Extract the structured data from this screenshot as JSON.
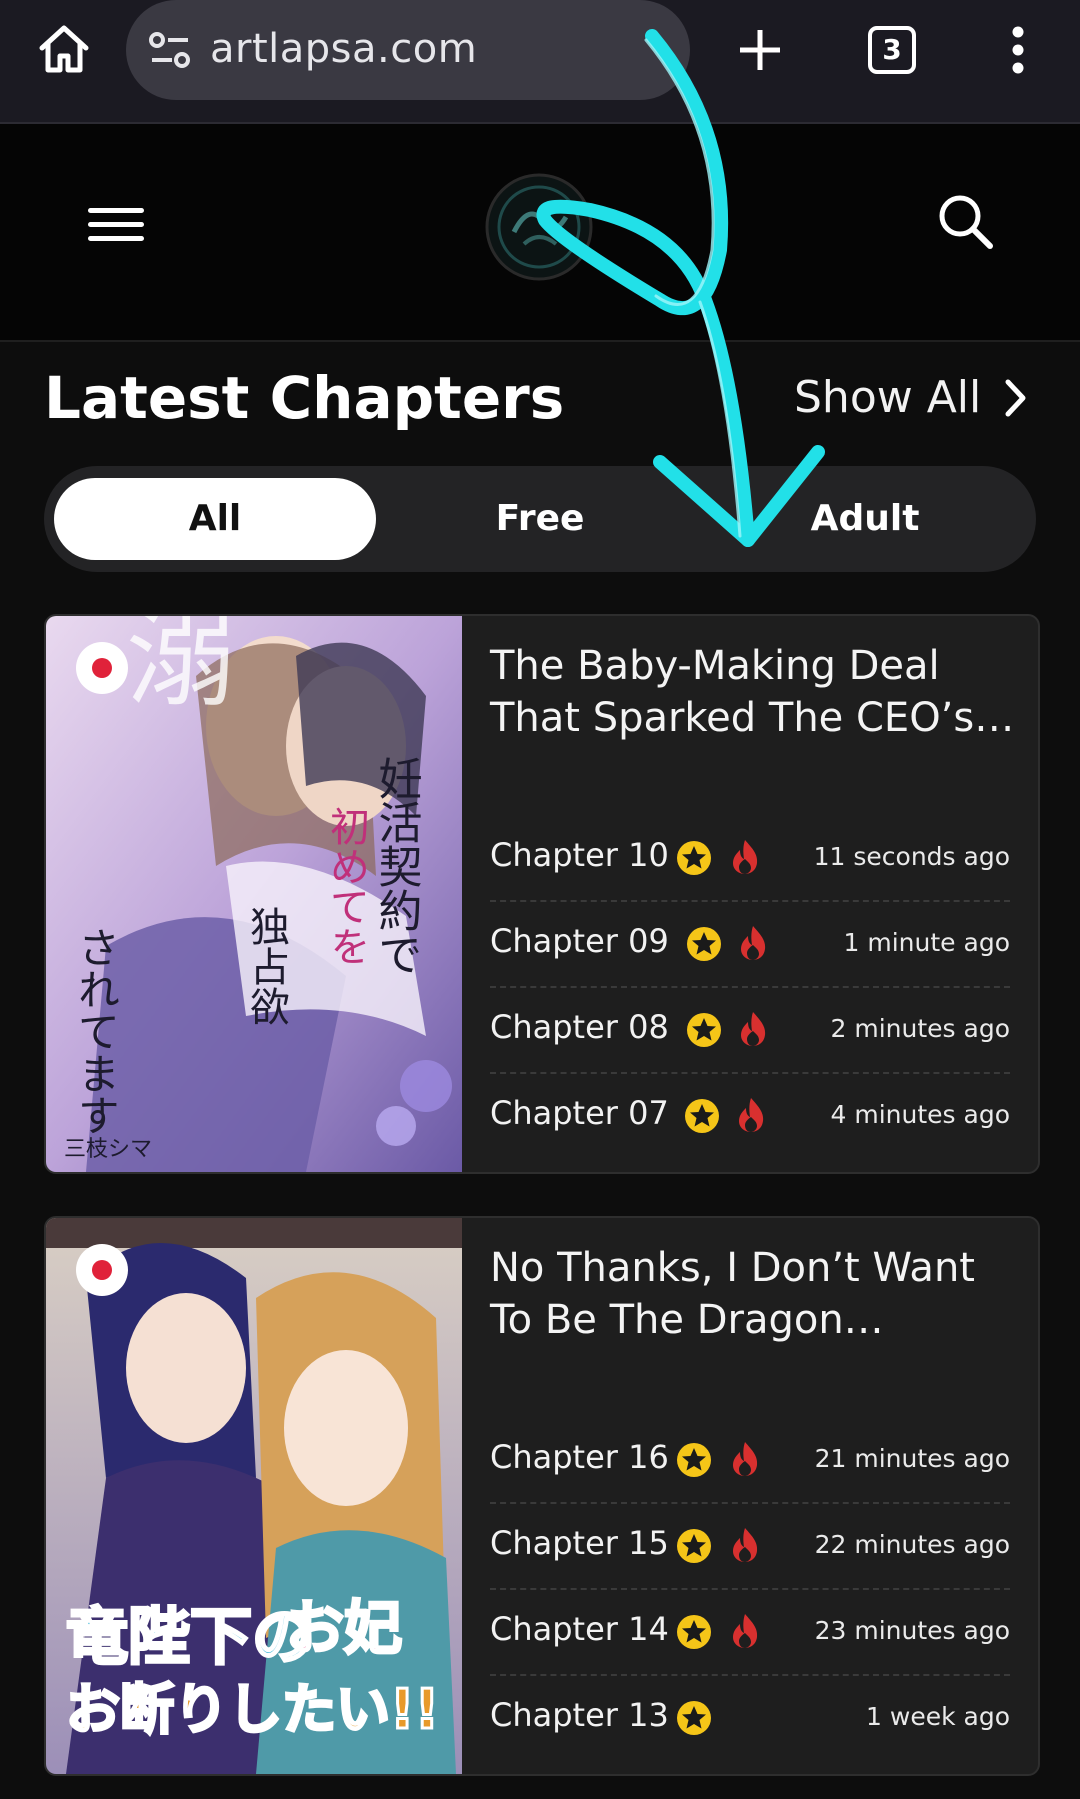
{
  "browser": {
    "url": "artlapsa.com",
    "tab_count": "3"
  },
  "section": {
    "title": "Latest Chapters",
    "show_all": "Show All"
  },
  "filters": [
    {
      "label": "All",
      "active": true
    },
    {
      "label": "Free",
      "active": false
    },
    {
      "label": "Adult",
      "active": false
    }
  ],
  "cards": [
    {
      "title_line1": "The Baby-Making Deal",
      "title_line2": "That Sparked The CEO’s…",
      "chapters": [
        {
          "name": "Chapter 10",
          "time": "11 seconds ago",
          "star": true,
          "fire": true
        },
        {
          "name": "Chapter 09",
          "time": "1 minute ago",
          "star": true,
          "fire": true
        },
        {
          "name": "Chapter 08",
          "time": "2 minutes ago",
          "star": true,
          "fire": true
        },
        {
          "name": "Chapter 07",
          "time": "4 minutes ago",
          "star": true,
          "fire": true
        }
      ]
    },
    {
      "title_line1": "No Thanks, I Don’t Want",
      "title_line2": "To Be The Dragon…",
      "chapters": [
        {
          "name": "Chapter 16",
          "time": "21 minutes ago",
          "star": true,
          "fire": true
        },
        {
          "name": "Chapter 15",
          "time": "22 minutes ago",
          "star": true,
          "fire": true
        },
        {
          "name": "Chapter 14",
          "time": "23 minutes ago",
          "star": true,
          "fire": true
        },
        {
          "name": "Chapter 13",
          "time": "1 week ago",
          "star": true,
          "fire": false
        }
      ]
    }
  ],
  "icons": {
    "home": "home-icon",
    "site_info": "tune-icon",
    "new_tab": "plus-icon",
    "menu": "more-vert-icon",
    "hamburger": "hamburger-icon",
    "search": "search-icon",
    "chevron": "chevron-right-icon",
    "star": "star-icon",
    "fire": "fire-icon"
  },
  "colors": {
    "background": "#0d0d0d",
    "card": "#1e1e1e",
    "star": "#f5c518",
    "fire": "#d8302f",
    "annotation": "#22e0e8"
  }
}
